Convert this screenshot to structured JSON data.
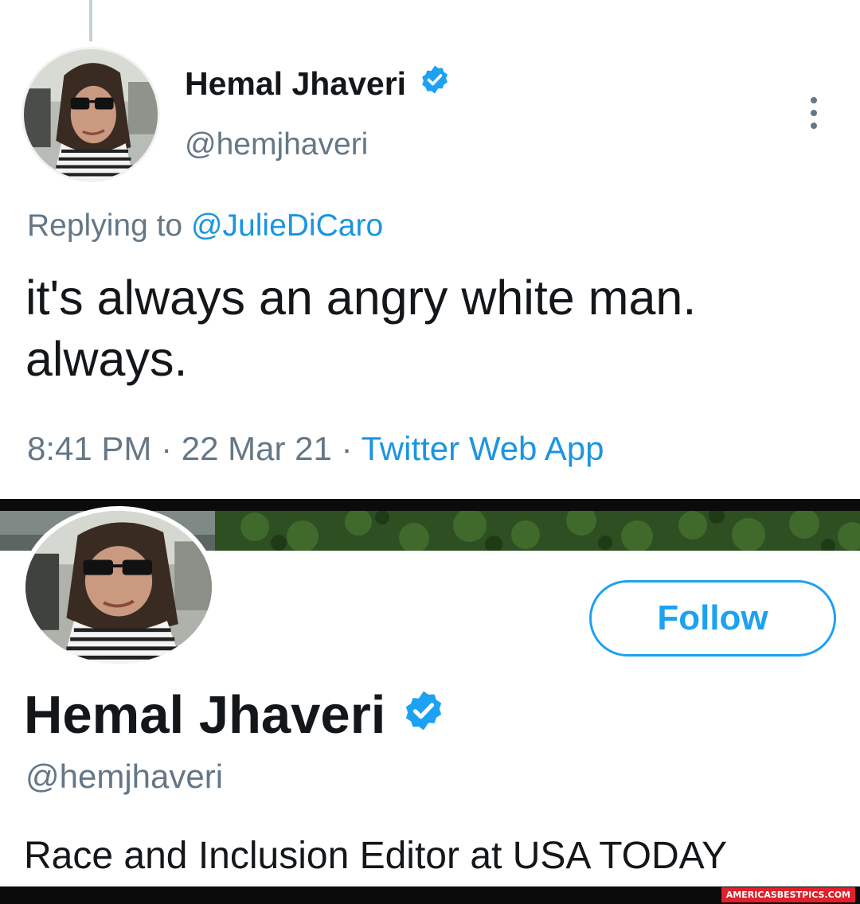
{
  "tweet": {
    "author_name": "Hemal Jhaveri",
    "author_handle": "@hemjhaveri",
    "replying_label": "Replying to",
    "replying_to": "@JulieDiCaro",
    "text_line1": "it's always an angry white man.",
    "text_line2": "always.",
    "time": "8:41 PM",
    "date": "22 Mar 21",
    "source": "Twitter Web App",
    "separator": "·",
    "verified_icon": "verified-badge-icon",
    "more_icon": "more-options-icon"
  },
  "profile": {
    "name": "Hemal Jhaveri",
    "handle": "@hemjhaveri",
    "bio": "Race and Inclusion Editor at USA TODAY",
    "follow_label": "Follow"
  },
  "watermark": "AMERICASBESTPICS.COM",
  "colors": {
    "accent": "#1da1f2",
    "link": "#1b95e0",
    "secondary_text": "#657786",
    "primary_text": "#14171a",
    "separator": "#0b0b0b",
    "watermark_bg": "#e0202a"
  }
}
